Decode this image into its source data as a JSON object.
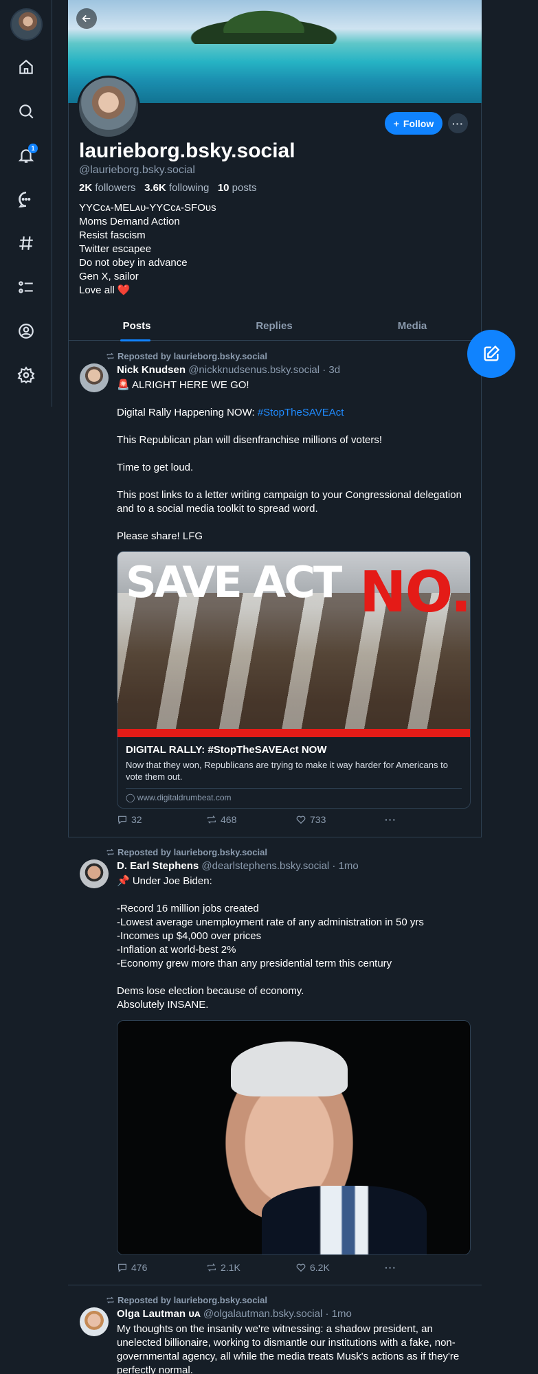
{
  "nav": {
    "notifications_badge": "1"
  },
  "profile": {
    "display_name": "laurieborg.bsky.social",
    "handle": "@laurieborg.bsky.social",
    "followers_count": "2K",
    "followers_label": "followers",
    "following_count": "3.6K",
    "following_label": "following",
    "posts_count": "10",
    "posts_label": "posts",
    "follow_label": "Follow",
    "bio_lines": [
      "YYCᴄᴀ-MELᴀᴜ-YYCᴄᴀ-SFOᴜs",
      "Moms Demand Action",
      "Resist fascism",
      "Twitter escapee",
      "Do not obey in advance",
      "Gen X, sailor",
      "Love all"
    ],
    "bio_heart": "❤️"
  },
  "tabs": [
    "Posts",
    "Replies",
    "Media"
  ],
  "posts": [
    {
      "repost_label": "Reposted by laurieborg.bsky.social",
      "author_name": "Nick Knudsen",
      "author_handle": "@nickknudsenus.bsky.social · 3d",
      "lines": [
        "🚨 ALRIGHT HERE WE GO!",
        "",
        "Digital Rally Happening NOW: ",
        "",
        "This Republican plan will disenfranchise millions of voters!",
        "",
        "Time to get loud.",
        "",
        "This post links to a letter writing campaign to your Congressional delegation and to a social media toolkit to spread word.",
        "",
        "Please share! LFG"
      ],
      "hashtag": "#StopTheSAVEAct",
      "embed": {
        "image_text_white": "SAVE ACT",
        "image_text_red": "NO.",
        "title": "DIGITAL RALLY: #StopTheSAVEAct NOW",
        "description": "Now that they won, Republicans are trying to make it way harder for Americans to vote them out.",
        "domain": "www.digitaldrumbeat.com"
      },
      "replies": "32",
      "reposts": "468",
      "likes": "733"
    },
    {
      "repost_label": "Reposted by laurieborg.bsky.social",
      "author_name": "D. Earl Stephens",
      "author_handle": "@dearlstephens.bsky.social · 1mo",
      "lines": [
        "📌 Under Joe Biden:",
        "",
        "-Record 16 million jobs created",
        "-Lowest average unemployment rate of any administration in 50 yrs",
        "-Incomes up $4,000 over prices",
        "-Inflation at world-best 2%",
        "-Economy grew more than any presidential term this century",
        "",
        "Dems lose election because of economy.",
        "Absolutely INSANE."
      ],
      "replies": "476",
      "reposts": "2.1K",
      "likes": "6.2K"
    },
    {
      "repost_label": "Reposted by laurieborg.bsky.social",
      "author_name": "Olga Lautman",
      "author_suffix": "ᴜᴀ",
      "author_handle": "@olgalautman.bsky.social · 1mo",
      "text": "My thoughts on the insanity we're witnessing: a shadow president, an unelected billionaire, working to dismantle our institutions with a fake, non-governmental agency, all while the media treats Musk's actions as if they're perfectly normal."
    }
  ]
}
